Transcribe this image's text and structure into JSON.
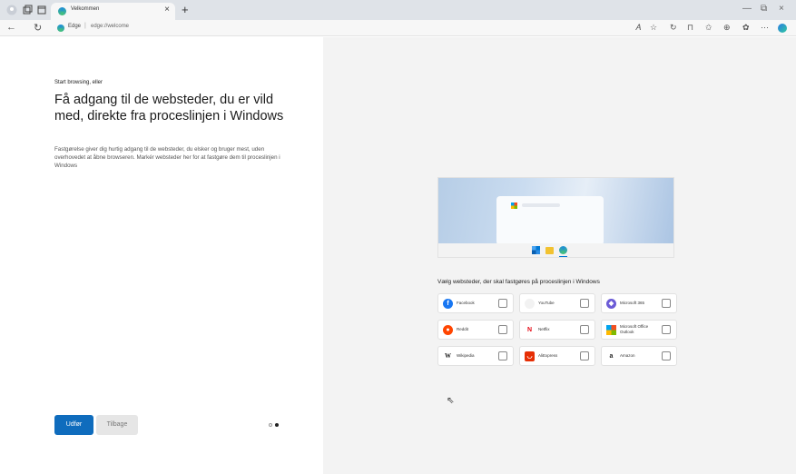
{
  "browser": {
    "tab_title": "Velkommen",
    "tab_close": "×",
    "new_tab": "+",
    "address_source": "Edge",
    "address_separator": "|",
    "address_url": "edge://welcome",
    "toolbar_icons": [
      "read-aloud-icon",
      "favorite-star-icon",
      "refresh-icon",
      "reading-view-icon",
      "favorites-icon",
      "collections-icon",
      "extensions-icon",
      "more-icon"
    ],
    "nav": {
      "back": "←",
      "refresh": "↻"
    },
    "window": {
      "minimize": "—",
      "restore": "⧉",
      "close": "×"
    }
  },
  "welcome": {
    "pretitle": "Start browsing, eller",
    "heading": "Få adgang til de websteder, du er vild med, direkte fra proceslinjen i Windows",
    "description": "Fastgørelse giver dig hurtig adgang til de websteder, du elsker og bruger mest, uden overhovedet at åbne browseren. Markér websteder her for at fastgøre dem til proceslinjen i Windows",
    "next_label": "Udfør",
    "back_label": "Tilbage"
  },
  "sites": {
    "title": "Vælg websteder, der skal fastgøres på proceslinjen i Windows",
    "tiles": [
      {
        "name": "Facebook",
        "color": "#1877f2",
        "glyph": "f"
      },
      {
        "name": "YouTube",
        "color": "#f2f2f2",
        "glyph": ""
      },
      {
        "name": "Microsoft 365",
        "color": "#6b5bd6",
        "glyph": "◆"
      },
      {
        "name": "Reddit",
        "color": "#ff4500",
        "glyph": "●"
      },
      {
        "name": "Netflix",
        "color": "#ffffff",
        "glyph": "N"
      },
      {
        "name": "Microsoft Office Outlook",
        "color": "#ffffff",
        "glyph": "▦"
      },
      {
        "name": "Wikipedia",
        "color": "#ffffff",
        "glyph": "W"
      },
      {
        "name": "AliExpress",
        "color": "#e62e04",
        "glyph": "◡"
      },
      {
        "name": "Amazon",
        "color": "#ffffff",
        "glyph": "a"
      }
    ]
  }
}
